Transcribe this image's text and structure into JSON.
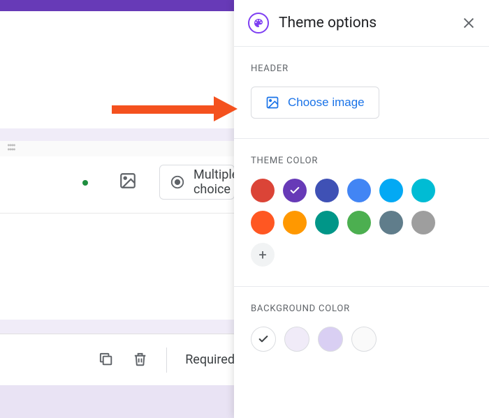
{
  "panel": {
    "title": "Theme options",
    "sections": {
      "header": {
        "label": "HEADER",
        "choose_label": "Choose image"
      },
      "theme_color": {
        "label": "THEME COLOR",
        "colors": [
          {
            "hex": "#db4437",
            "selected": false
          },
          {
            "hex": "#673ab7",
            "selected": true
          },
          {
            "hex": "#3f51b5",
            "selected": false
          },
          {
            "hex": "#4285f4",
            "selected": false
          },
          {
            "hex": "#03a9f4",
            "selected": false
          },
          {
            "hex": "#00bcd4",
            "selected": false
          },
          {
            "hex": "#ff5722",
            "selected": false
          },
          {
            "hex": "#ff9800",
            "selected": false
          },
          {
            "hex": "#009688",
            "selected": false
          },
          {
            "hex": "#4caf50",
            "selected": false
          },
          {
            "hex": "#607d8b",
            "selected": false
          },
          {
            "hex": "#9e9e9e",
            "selected": false
          }
        ]
      },
      "background_color": {
        "label": "BACKGROUND COLOR",
        "colors": [
          {
            "hex": "#ffffff",
            "selected": true
          },
          {
            "hex": "#f0ebf8",
            "selected": false
          },
          {
            "hex": "#d9cff3",
            "selected": false
          },
          {
            "hex": "#fafafa",
            "selected": false
          }
        ]
      }
    }
  },
  "background": {
    "question_type_label": "Multiple choice",
    "toolbar_text": "Required"
  }
}
